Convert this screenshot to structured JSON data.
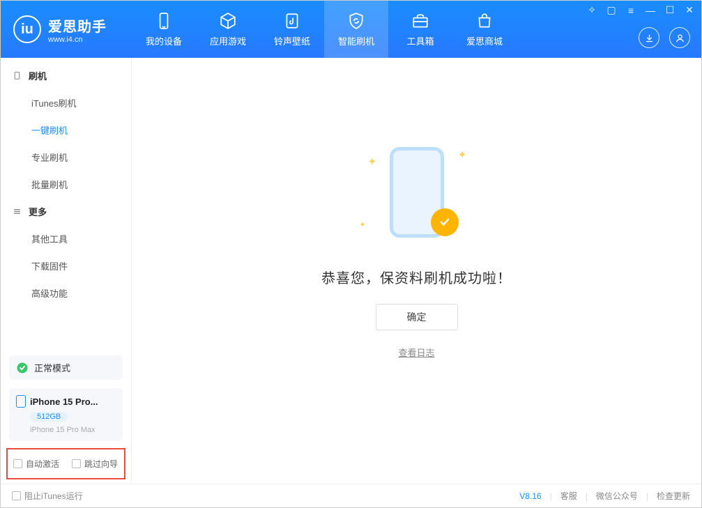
{
  "app": {
    "title": "爱思助手",
    "subtitle": "www.i4.cn"
  },
  "nav": {
    "device": "我的设备",
    "apps": "应用游戏",
    "ring": "铃声壁纸",
    "flash": "智能刷机",
    "tools": "工具箱",
    "store": "爱思商城"
  },
  "sidebar": {
    "group1": "刷机",
    "items1": [
      "iTunes刷机",
      "一键刷机",
      "专业刷机",
      "批量刷机"
    ],
    "group2": "更多",
    "items2": [
      "其他工具",
      "下载固件",
      "高级功能"
    ]
  },
  "device": {
    "status": "正常模式",
    "name": "iPhone 15 Pro...",
    "storage": "512GB",
    "model": "iPhone 15 Pro Max"
  },
  "checkboxes": {
    "auto_activate": "自动激活",
    "skip_guide": "跳过向导"
  },
  "main": {
    "success_title": "恭喜您，保资料刷机成功啦！",
    "ok": "确定",
    "log": "查看日志"
  },
  "footer": {
    "block_itunes": "阻止iTunes运行",
    "version": "V8.16",
    "support": "客服",
    "wechat": "微信公众号",
    "update": "检查更新"
  }
}
